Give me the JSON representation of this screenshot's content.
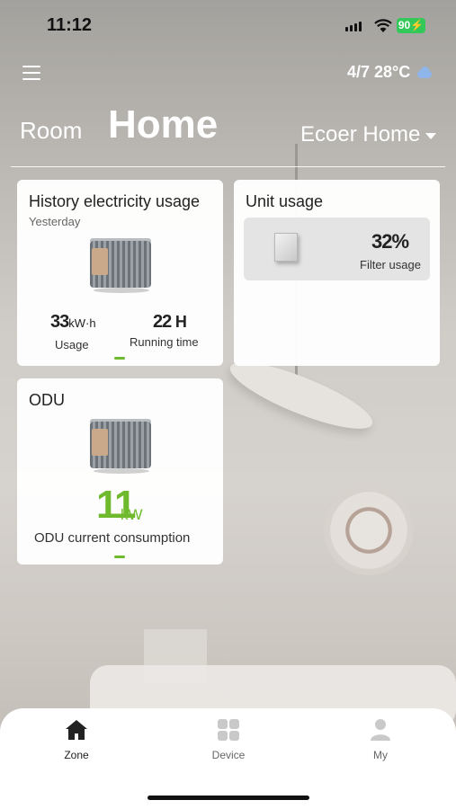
{
  "status_bar": {
    "time": "11:12",
    "battery": "90"
  },
  "header": {
    "weather_text": "4/7 28°C",
    "weather_icon": "cloud-icon",
    "tab_room": "Room",
    "tab_home": "Home",
    "home_selector": "Ecoer Home"
  },
  "history_card": {
    "title": "History electricity usage",
    "subtitle": "Yesterday",
    "usage_value": "33",
    "usage_unit": "kW·h",
    "usage_label": "Usage",
    "runtime_value": "22",
    "runtime_unit": "H",
    "runtime_label": "Running time"
  },
  "unit_card": {
    "title": "Unit usage",
    "filter_value": "32%",
    "filter_label": "Filter usage"
  },
  "odu_card": {
    "title": "ODU",
    "value": "11",
    "unit": "kW",
    "label": "ODU current consumption"
  },
  "bottom_nav": {
    "items": [
      {
        "label": "Zone",
        "icon": "house-icon",
        "active": true
      },
      {
        "label": "Device",
        "icon": "grid-icon",
        "active": false
      },
      {
        "label": "My",
        "icon": "person-icon",
        "active": false
      }
    ]
  },
  "colors": {
    "accent": "#6fba2c",
    "battery": "#34c759",
    "weather_icon": "#8fb6ea"
  }
}
